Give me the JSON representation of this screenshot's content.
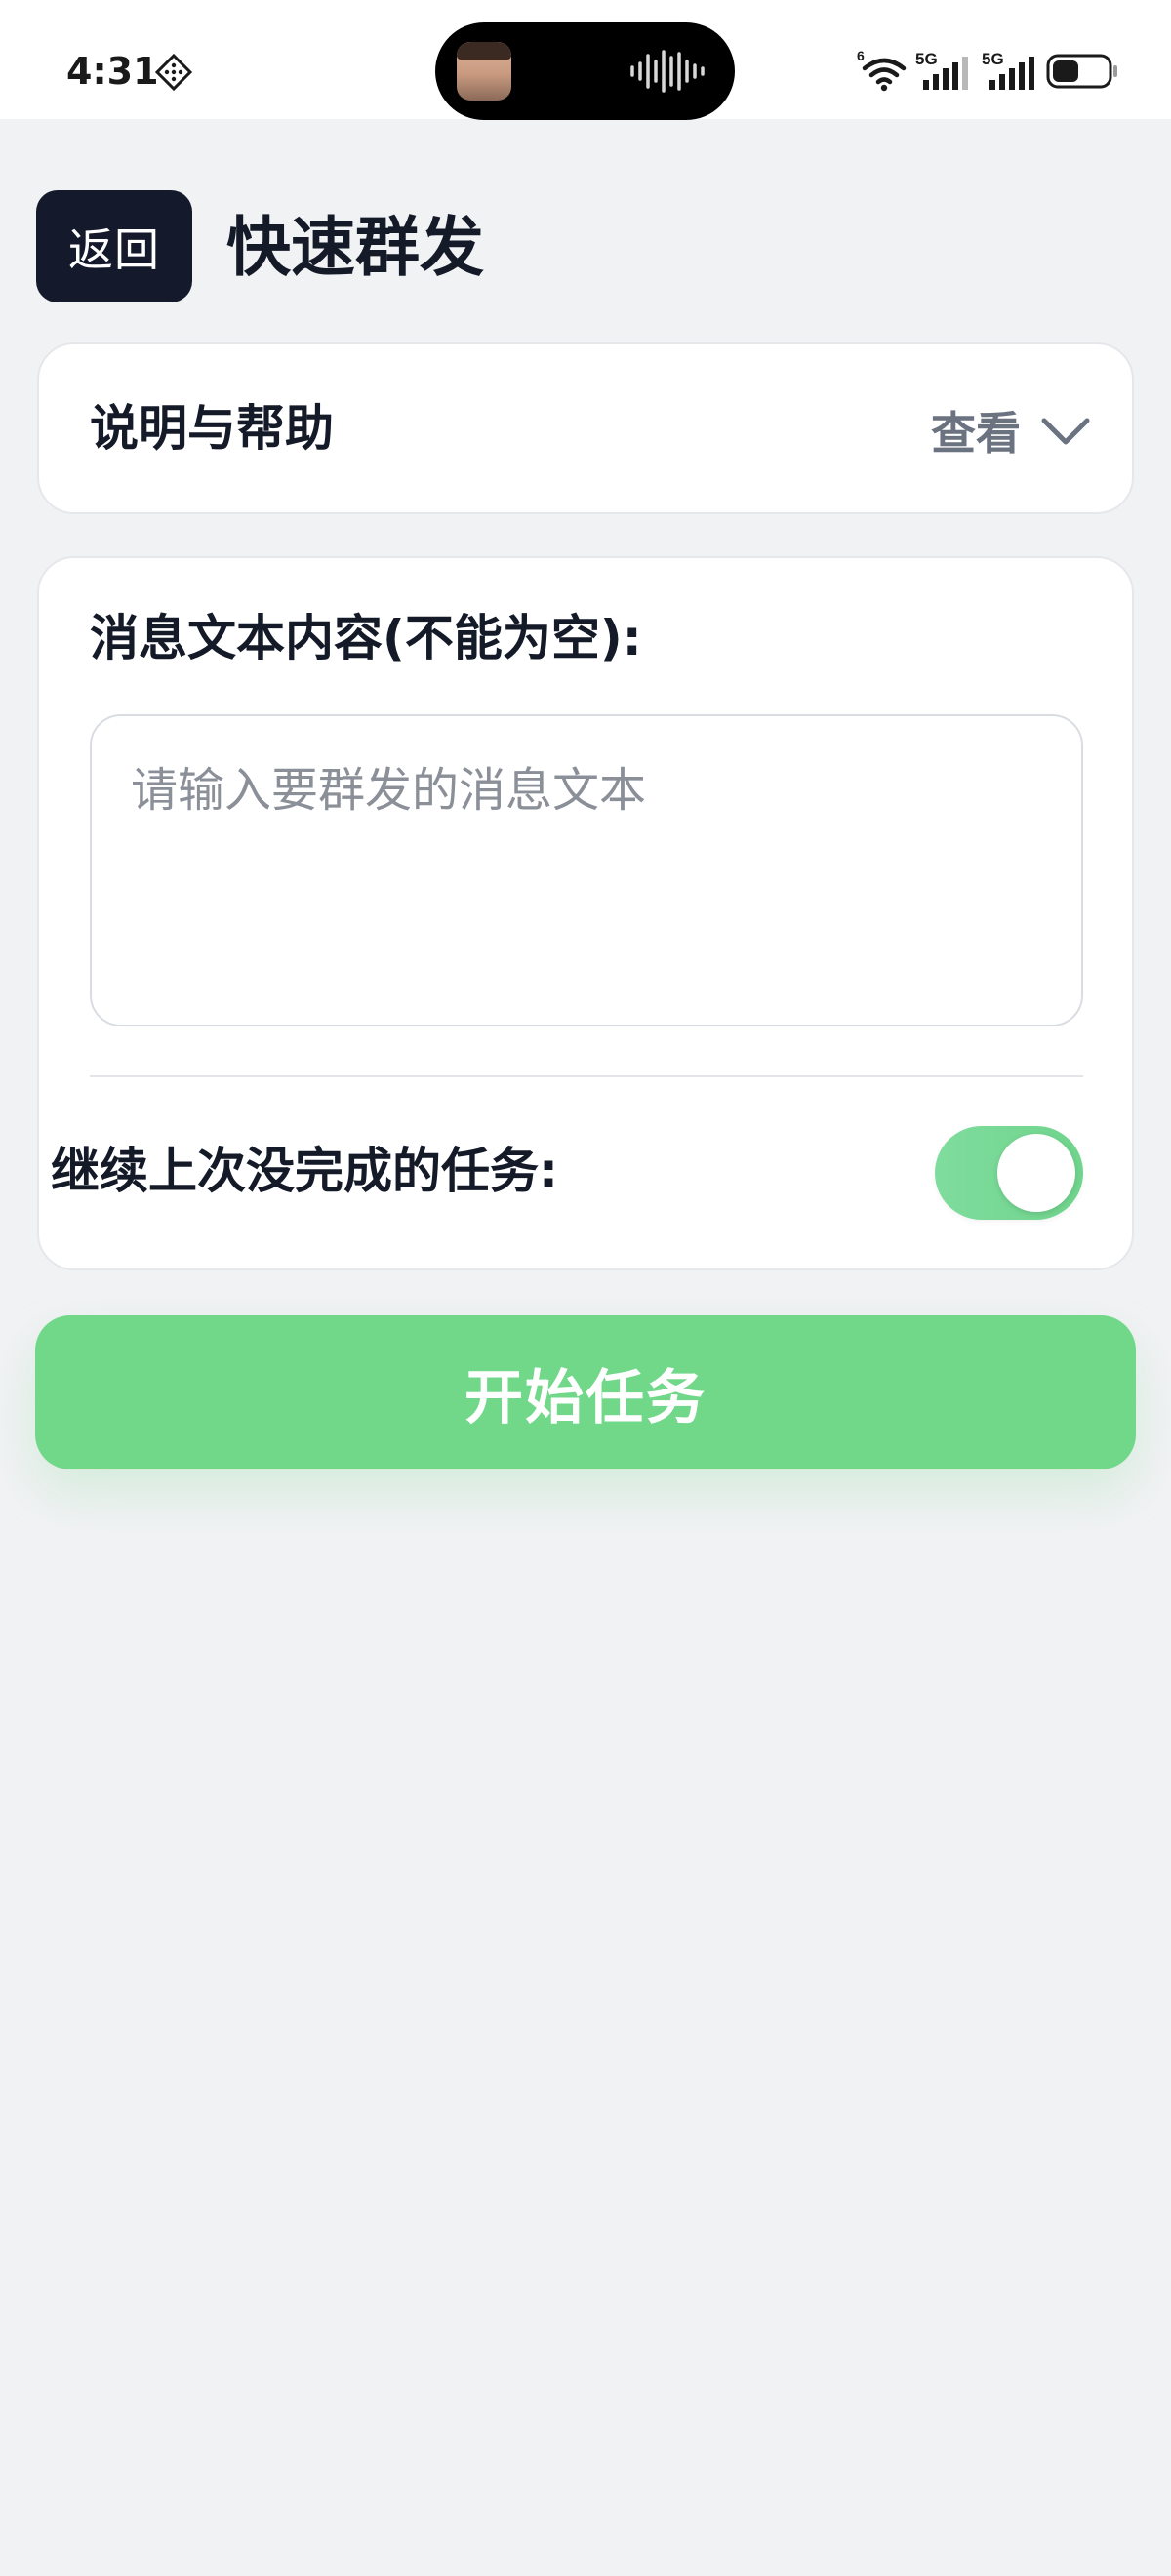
{
  "status_bar": {
    "time": "4:31",
    "notification_icon": "sparkle-diamond-icon",
    "network_icons": [
      "wifi-icon",
      "signal-5g-icon",
      "signal-5g-icon",
      "battery-icon"
    ],
    "network_labels": [
      "6",
      "5G",
      "5G"
    ]
  },
  "header": {
    "back_label": "返回",
    "title": "快速群发"
  },
  "help_card": {
    "title": "说明与帮助",
    "toggle_label": "查看",
    "toggle_icon": "chevron-down-icon"
  },
  "message_card": {
    "label": "消息文本内容(不能为空):",
    "input_value": "",
    "input_placeholder": "请输入要群发的消息文本",
    "continue_label": "继续上次没完成的任务:",
    "continue_enabled": true
  },
  "start_button": {
    "label": "开始任务"
  },
  "colors": {
    "accent_green": "#71d88a",
    "toggle_green": "#7fdc9d",
    "dark_button": "#141a2b",
    "page_background": "#f1f2f4"
  }
}
